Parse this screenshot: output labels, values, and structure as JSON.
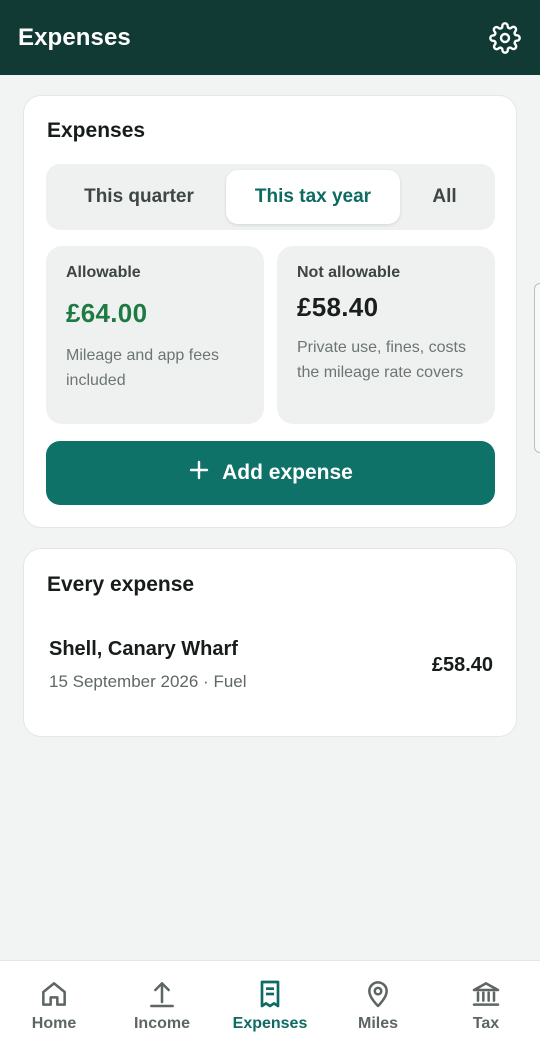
{
  "appbar": {
    "title": "Expenses",
    "settings_icon": "gear-icon"
  },
  "summary_card": {
    "title": "Expenses",
    "segments": [
      {
        "label": "This quarter",
        "selected": false
      },
      {
        "label": "This tax year",
        "selected": true
      },
      {
        "label": "All",
        "selected": false
      }
    ],
    "allowable": {
      "label": "Allowable",
      "value": "£64.00",
      "note": "Mileage and app fees included"
    },
    "not_allowable": {
      "label": "Not allowable",
      "value": "£58.40",
      "note": "Private use, fines, costs the mileage rate covers"
    },
    "add_button": {
      "label": "Add expense",
      "icon": "plus-icon"
    }
  },
  "list_card": {
    "title": "Every expense",
    "items": [
      {
        "title": "Shell, Canary Wharf",
        "subtitle": "15 September 2026 · Fuel",
        "amount": "£58.40"
      }
    ]
  },
  "bottom_nav": {
    "items": [
      {
        "label": "Home",
        "icon": "home-icon",
        "active": false
      },
      {
        "label": "Income",
        "icon": "upload-arrow-icon",
        "active": false
      },
      {
        "label": "Expenses",
        "icon": "receipt-icon",
        "active": true
      },
      {
        "label": "Miles",
        "icon": "location-pin-icon",
        "active": false
      },
      {
        "label": "Tax",
        "icon": "bank-icon",
        "active": false
      }
    ]
  },
  "colors": {
    "appbar": "#123a35",
    "accent": "#0e7269",
    "allowable_green": "#1e7a43",
    "background": "#f2f4f3"
  }
}
